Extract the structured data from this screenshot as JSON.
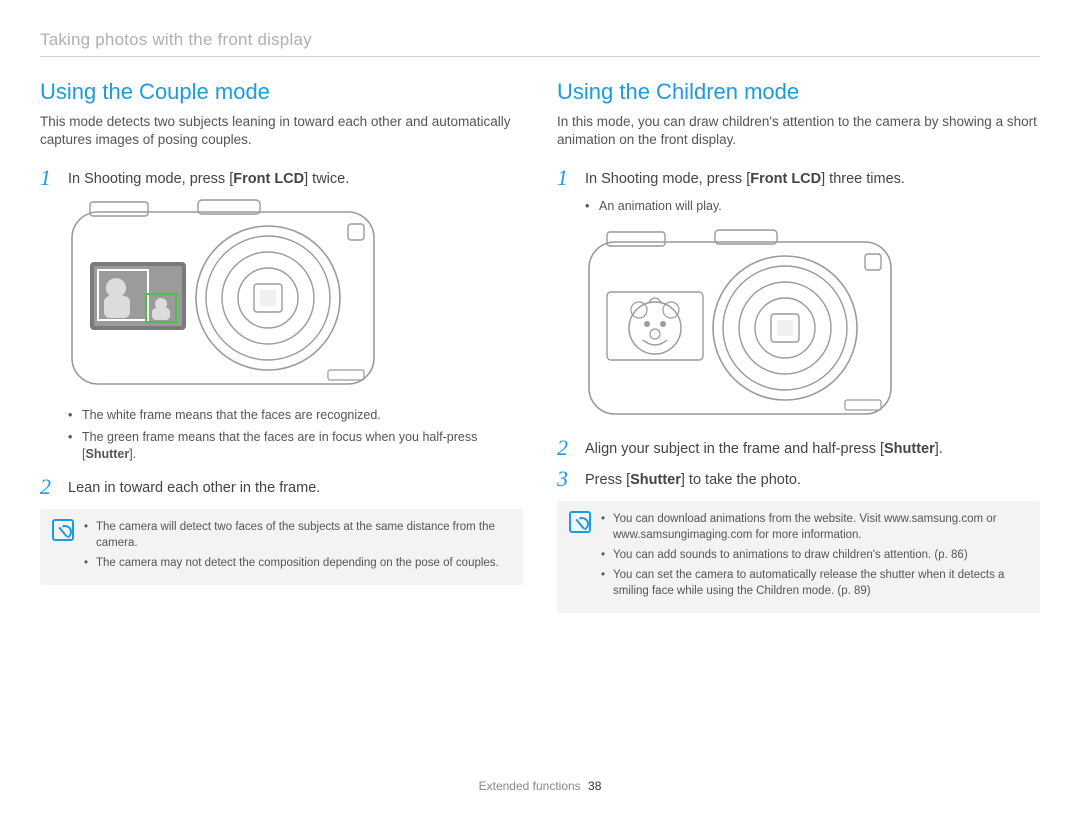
{
  "breadcrumb": "Taking photos with the front display",
  "left": {
    "heading": "Using the Couple mode",
    "desc": "This mode detects two subjects leaning in toward each other and automatically captures images of posing couples.",
    "step1_pre": "In Shooting mode, press [",
    "step1_bold": "Front LCD",
    "step1_post": "] twice.",
    "bullets": {
      "b1": "The white frame means that the faces are recognized.",
      "b2_pre": "The green frame means that the faces are in focus when you half-press [",
      "b2_bold": "Shutter",
      "b2_post": "]."
    },
    "step2": "Lean in toward each other in the frame.",
    "notes": {
      "n1": "The camera will detect two faces of the subjects at the same distance from the camera.",
      "n2": "The camera may not detect the composition depending on the pose of couples."
    }
  },
  "right": {
    "heading": "Using the Children mode",
    "desc": "In this mode, you can draw children's attention to the camera by showing a short animation on the front display.",
    "step1_pre": "In Shooting mode, press [",
    "step1_bold": "Front LCD",
    "step1_post": "] three times.",
    "sub1": "An animation will play.",
    "step2_pre": "Align your subject in the frame and half-press [",
    "step2_bold": "Shutter",
    "step2_post": "].",
    "step3_pre": "Press [",
    "step3_bold": "Shutter",
    "step3_post": "] to take the photo.",
    "notes": {
      "n1": "You can download animations from the website. Visit www.samsung.com or www.samsungimaging.com for more information.",
      "n2": "You can add sounds to animations to draw children's attention. (p. 86)",
      "n3": "You can set the camera to automatically release the shutter when it detects a smiling face while using the Children mode. (p. 89)"
    }
  },
  "footer_label": "Extended functions",
  "footer_page": "38"
}
